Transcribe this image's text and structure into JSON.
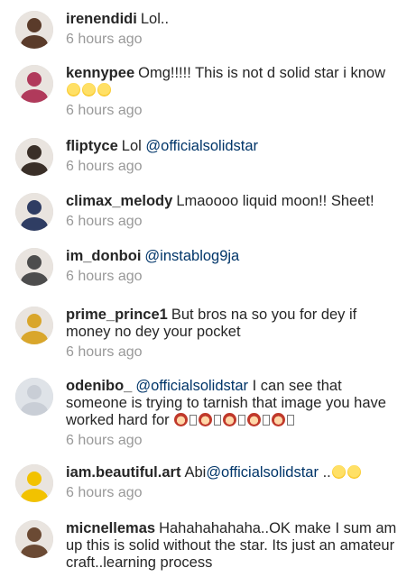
{
  "comments": [
    {
      "username": "irenendidi",
      "parts": [
        {
          "t": "text",
          "v": "Lol.."
        }
      ],
      "time": "6 hours ago",
      "avatar": "#5a3b2a"
    },
    {
      "username": "kennypee",
      "parts": [
        {
          "t": "text",
          "v": "Omg!!!!! This is not d solid star i know "
        },
        {
          "t": "emoji",
          "v": "laughing-tears-emoji"
        },
        {
          "t": "emoji",
          "v": "laughing-tears-emoji"
        },
        {
          "t": "emoji",
          "v": "grinning-emoji"
        }
      ],
      "time": "6 hours ago",
      "avatar": "#b03a5b"
    },
    {
      "username": "fliptyce",
      "parts": [
        {
          "t": "text",
          "v": "Lol "
        },
        {
          "t": "mention",
          "v": "@officialsolidstar"
        }
      ],
      "time": "6 hours ago",
      "avatar": "#3a2f28"
    },
    {
      "username": "climax_melody",
      "parts": [
        {
          "t": "text",
          "v": "Lmaoooo liquid moon!! Sheet!"
        }
      ],
      "time": "6 hours ago",
      "avatar": "#2f3d63"
    },
    {
      "username": "im_donboi",
      "parts": [
        {
          "t": "mention",
          "v": "@instablog9ja"
        }
      ],
      "time": "6 hours ago",
      "avatar": "#4d4d4d"
    },
    {
      "username": "prime_prince1",
      "parts": [
        {
          "t": "text",
          "v": "But bros na so you for dey if money no dey your pocket"
        }
      ],
      "time": "6 hours ago",
      "avatar": "#d9a62b"
    },
    {
      "username": "odenibo_",
      "parts": [
        {
          "t": "mention",
          "v": "@officialsolidstar"
        },
        {
          "t": "text",
          "v": " I can see that someone is trying to tarnish that image you have worked hard for "
        },
        {
          "t": "emoji",
          "v": "woman-face-emoji"
        },
        {
          "t": "box",
          "v": "missing-glyph"
        },
        {
          "t": "emoji",
          "v": "woman-face-emoji"
        },
        {
          "t": "box",
          "v": "missing-glyph"
        },
        {
          "t": "emoji",
          "v": "woman-face-emoji"
        },
        {
          "t": "box",
          "v": "missing-glyph"
        },
        {
          "t": "emoji",
          "v": "woman-face-emoji"
        },
        {
          "t": "box",
          "v": "missing-glyph"
        },
        {
          "t": "emoji",
          "v": "woman-face-emoji"
        },
        {
          "t": "box",
          "v": "missing-glyph"
        }
      ],
      "time": "6 hours ago",
      "avatar": "#c9ced6"
    },
    {
      "username": "iam.beautiful.art",
      "parts": [
        {
          "t": "text",
          "v": "Abi"
        },
        {
          "t": "mention",
          "v": "@officialsolidstar"
        },
        {
          "t": "text",
          "v": " .."
        },
        {
          "t": "emoji",
          "v": "laughing-tears-emoji"
        },
        {
          "t": "emoji",
          "v": "grinning-emoji"
        }
      ],
      "time": "6 hours ago",
      "avatar": "#f2c200"
    },
    {
      "username": "micnellemas",
      "parts": [
        {
          "t": "text",
          "v": "Hahahahahaha..OK make I sum am up this is solid without the star. Its just an amateur craft..learning process"
        }
      ],
      "time": "",
      "avatar": "#6b4a34"
    }
  ]
}
